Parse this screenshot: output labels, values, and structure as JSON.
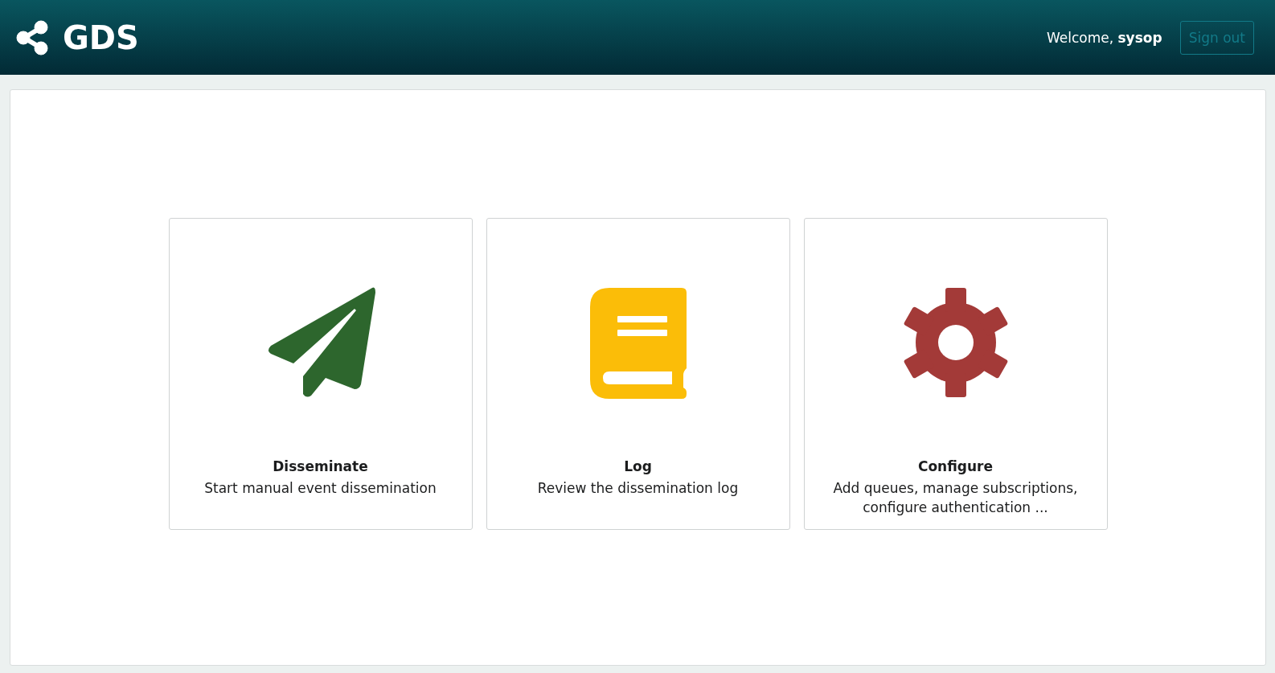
{
  "header": {
    "title": "GDS",
    "welcome": "Welcome, **sysop**",
    "sign_out": "Sign out"
  },
  "cards": [
    {
      "kind": "send",
      "color": "#2d662d",
      "title": "Disseminate",
      "description": "Start manual event dissemination"
    },
    {
      "kind": "log",
      "color": "#fbbd08",
      "title": "Log",
      "description": "Review the dissemination log"
    },
    {
      "kind": "settings",
      "color": "#a33a38",
      "title": "Configure",
      "description": "Add queues, manage subscriptions, configure authentication ..."
    }
  ]
}
